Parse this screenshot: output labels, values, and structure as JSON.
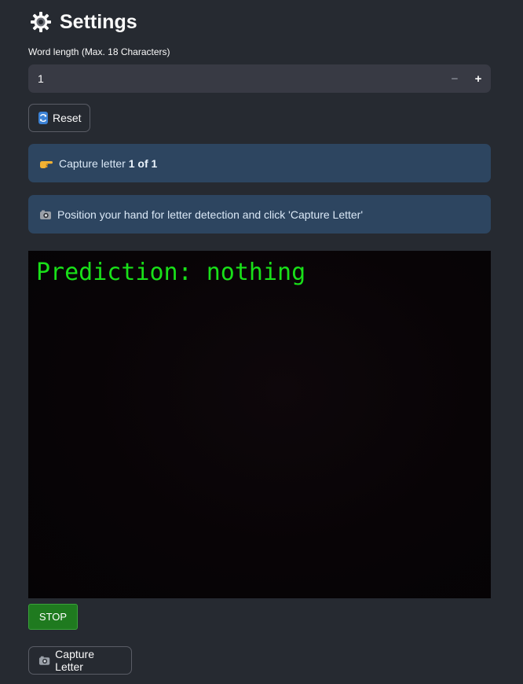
{
  "header": {
    "title": "Settings",
    "icon": "gear-icon"
  },
  "word_length": {
    "label": "Word length (Max. 18 Characters)",
    "value": "1",
    "decrement_label": "−",
    "increment_label": "+"
  },
  "reset_button": {
    "label": "Reset",
    "icon": "sync-icon"
  },
  "alerts": [
    {
      "icon": "pointing-hand-icon",
      "prefix": "Capture letter ",
      "emphasis": "1 of 1"
    },
    {
      "icon": "camera-icon",
      "text": "Position your hand for letter detection and click 'Capture Letter'"
    }
  ],
  "video_feed": {
    "overlay_text": "Prediction: nothing",
    "overlay_color": "#19e019"
  },
  "stop_button": {
    "label": "STOP"
  },
  "capture_button": {
    "label": "Capture Letter",
    "icon": "camera-icon"
  },
  "colors": {
    "background": "#262a31",
    "input_bg": "#383a44",
    "alert_bg": "#2d4560",
    "stop_bg": "#1f7a1f"
  }
}
